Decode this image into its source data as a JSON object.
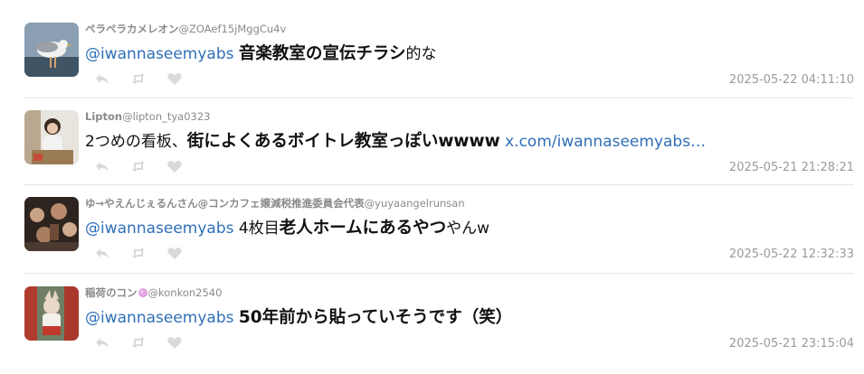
{
  "tweets": [
    {
      "name": "ペラペラカメレオン",
      "handle": "@ZOAef15jMggCu4v",
      "badge": false,
      "segments": [
        {
          "type": "mention",
          "text": "@iwannaseemyabs"
        },
        {
          "type": "plain",
          "text": " "
        },
        {
          "type": "bold",
          "text": "音楽教室の宣伝チラシ"
        },
        {
          "type": "plain",
          "text": "的な"
        }
      ],
      "timestamp": "2025-05-22 04:11:10",
      "avatar": "seagull"
    },
    {
      "name": "Lipton",
      "handle": "@lipton_tya0323",
      "badge": false,
      "segments": [
        {
          "type": "plain",
          "text": "2つめの看板、"
        },
        {
          "type": "bold",
          "text": "街によくあるボイトレ教室っぽいwwww"
        },
        {
          "type": "plain",
          "text": " "
        },
        {
          "type": "link",
          "text": "x.com/iwannaseemyabs…"
        }
      ],
      "timestamp": "2025-05-21 21:28:21",
      "avatar": "person"
    },
    {
      "name": "ゆ→やえんじぇるんさん@コンカフェ嬢減税推進委員会代表",
      "handle": "@yuyaangelrunsan",
      "badge": false,
      "segments": [
        {
          "type": "mention",
          "text": "@iwannaseemyabs"
        },
        {
          "type": "plain",
          "text": " 4枚目"
        },
        {
          "type": "bold",
          "text": "老人ホームにあるやつ"
        },
        {
          "type": "plain",
          "text": "やんw"
        }
      ],
      "timestamp": "2025-05-22 12:32:33",
      "avatar": "crowd"
    },
    {
      "name": "稲荷のコン",
      "handle": "@konkon2540",
      "badge": true,
      "segments": [
        {
          "type": "mention",
          "text": "@iwannaseemyabs"
        },
        {
          "type": "plain",
          "text": " "
        },
        {
          "type": "bold",
          "text": "50年前から貼っていそうです（笑）"
        }
      ],
      "timestamp": "2025-05-21 23:15:04",
      "avatar": "fox-girl"
    }
  ],
  "actions": {
    "reply_icon": "reply-icon",
    "retweet_icon": "retweet-icon",
    "like_icon": "heart-icon",
    "icon_color": "#d9d9d9"
  },
  "colors": {
    "link": "#2f6fb8",
    "meta": "#8a8a8a",
    "divider": "#e6e6e6"
  }
}
